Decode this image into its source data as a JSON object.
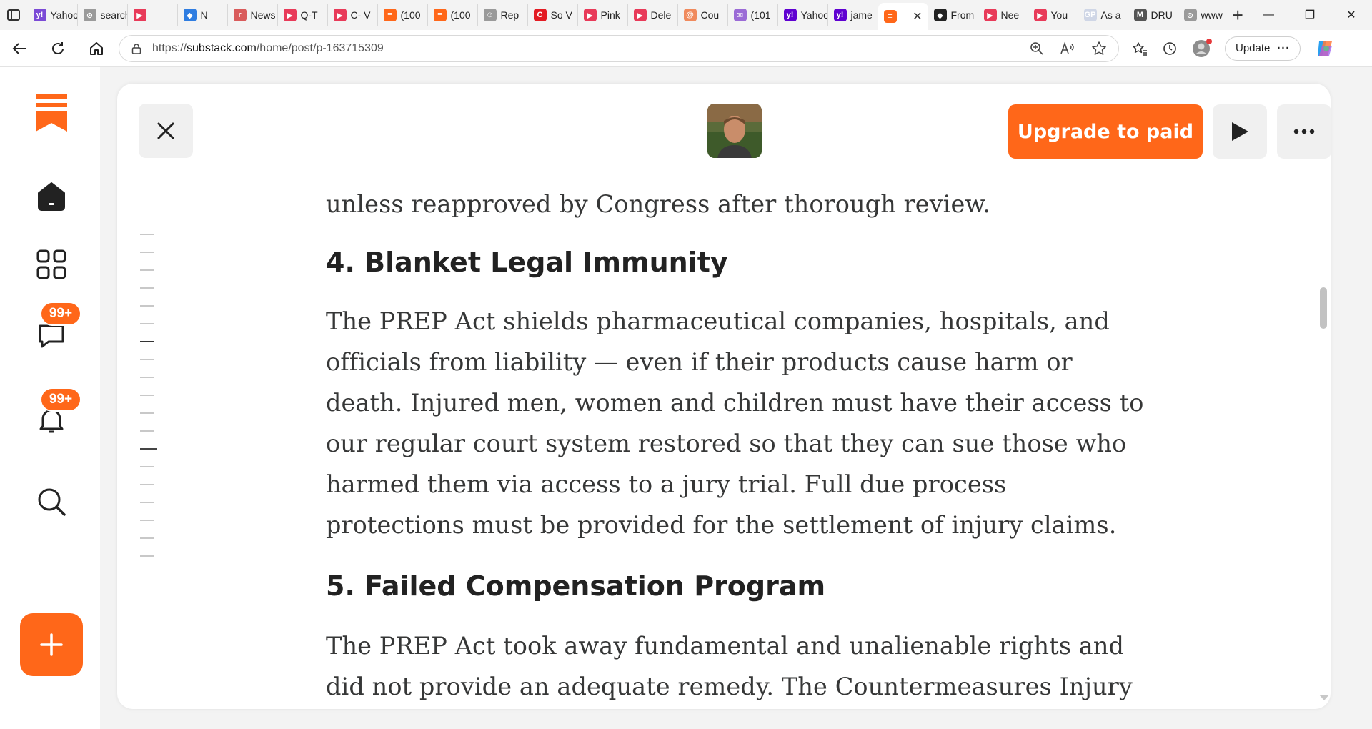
{
  "browser": {
    "tabs": [
      {
        "label": "Yahoo",
        "color": "#7b4ad6",
        "glyph": "y!"
      },
      {
        "label": "search",
        "color": "#9a9a9a",
        "glyph": "⊙"
      },
      {
        "label": "",
        "color": "#e83a59",
        "glyph": "▶"
      },
      {
        "label": "N",
        "color": "#2f7de1",
        "glyph": "◆"
      },
      {
        "label": "News",
        "color": "#d95b5b",
        "glyph": "r"
      },
      {
        "label": "Q-T",
        "color": "#e83a59",
        "glyph": "▶"
      },
      {
        "label": "C- V",
        "color": "#e83a59",
        "glyph": "▶"
      },
      {
        "label": "(100",
        "color": "#ff6719",
        "glyph": "≡"
      },
      {
        "label": "(100",
        "color": "#ff6719",
        "glyph": "≡"
      },
      {
        "label": "Rep",
        "color": "#9a9a9a",
        "glyph": "☺"
      },
      {
        "label": "So V",
        "color": "#e31b23",
        "glyph": "C"
      },
      {
        "label": "Pink",
        "color": "#e83a59",
        "glyph": "▶"
      },
      {
        "label": "Dele",
        "color": "#e83a59",
        "glyph": "▶"
      },
      {
        "label": "Cou",
        "color": "#f08a5d",
        "glyph": "@"
      },
      {
        "label": "(101",
        "color": "#9b6bd6",
        "glyph": "✉"
      },
      {
        "label": "Yahoo",
        "color": "#5f01d1",
        "glyph": "y!"
      },
      {
        "label": "jame",
        "color": "#5f01d1",
        "glyph": "y!"
      },
      {
        "label": "",
        "color": "#ff6719",
        "glyph": "≡"
      },
      {
        "label": "From",
        "color": "#222222",
        "glyph": "◆"
      },
      {
        "label": "Nee",
        "color": "#e83a59",
        "glyph": "▶"
      },
      {
        "label": "You",
        "color": "#e83a59",
        "glyph": "▶"
      },
      {
        "label": "As a",
        "color": "#cfd6e6",
        "glyph": "GP"
      },
      {
        "label": "DRU",
        "color": "#555555",
        "glyph": "M"
      },
      {
        "label": "www",
        "color": "#9a9a9a",
        "glyph": "⊙"
      }
    ],
    "url_prefix": "https://",
    "url_host": "substack.com",
    "url_path": "/home/post/p-163715309",
    "update_label": "Update"
  },
  "rail": {
    "chat_badge": "99+",
    "notifications_badge": "99+"
  },
  "post_header": {
    "upgrade_label": "Upgrade to paid"
  },
  "article": {
    "intro_tail": "unless reapproved by Congress after thorough review.",
    "section4_heading": "4. Blanket Legal Immunity",
    "section4_body": "The PREP Act shields pharmaceutical companies, hospitals, and officials from liability — even if their products cause harm or death. Injured men, women and children must have their access to our regular court system restored so that they can sue those who harmed them via access to a jury trial. Full due process protections must be provided for the settlement of injury claims.",
    "section5_heading": "5. Failed Compensation Program",
    "section5_body": "The PREP Act took away fundamental and unalienable rights and did not provide an adequate remedy. The Countermeasures Injury"
  },
  "colors": {
    "brand_orange": "#ff6719",
    "text": "#363737"
  }
}
